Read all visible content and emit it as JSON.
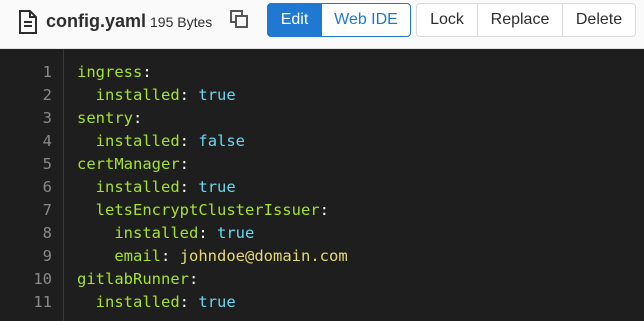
{
  "file": {
    "name": "config.yaml",
    "size": "195 Bytes",
    "file_icon": "file-icon",
    "copy_icon": "copy-icon"
  },
  "toolbar": {
    "edit_label": "Edit",
    "webide_label": "Web IDE",
    "lock_label": "Lock",
    "replace_label": "Replace",
    "delete_label": "Delete"
  },
  "colors": {
    "primary": "#1f78d1",
    "editor_bg": "#1e1e1e",
    "yaml_key": "#a6e22e",
    "yaml_bool": "#66d9ef",
    "yaml_string": "#e6db74"
  },
  "code_lines": [
    {
      "n": "1",
      "indent": "",
      "key": "ingress",
      "colon": ":",
      "value": "",
      "value_type": ""
    },
    {
      "n": "2",
      "indent": "  ",
      "key": "installed",
      "colon": ":",
      "value": "true",
      "value_type": "kw"
    },
    {
      "n": "3",
      "indent": "",
      "key": "sentry",
      "colon": ":",
      "value": "",
      "value_type": ""
    },
    {
      "n": "4",
      "indent": "  ",
      "key": "installed",
      "colon": ":",
      "value": "false",
      "value_type": "kw"
    },
    {
      "n": "5",
      "indent": "",
      "key": "certManager",
      "colon": ":",
      "value": "",
      "value_type": ""
    },
    {
      "n": "6",
      "indent": "  ",
      "key": "installed",
      "colon": ":",
      "value": "true",
      "value_type": "kw"
    },
    {
      "n": "7",
      "indent": "  ",
      "key": "letsEncryptClusterIssuer",
      "colon": ":",
      "value": "",
      "value_type": ""
    },
    {
      "n": "8",
      "indent": "    ",
      "key": "installed",
      "colon": ":",
      "value": "true",
      "value_type": "kw"
    },
    {
      "n": "9",
      "indent": "    ",
      "key": "email",
      "colon": ":",
      "value": "johndoe@domain.com",
      "value_type": "str"
    },
    {
      "n": "10",
      "indent": "",
      "key": "gitlabRunner",
      "colon": ":",
      "value": "",
      "value_type": ""
    },
    {
      "n": "11",
      "indent": "  ",
      "key": "installed",
      "colon": ":",
      "value": "true",
      "value_type": "kw"
    }
  ]
}
